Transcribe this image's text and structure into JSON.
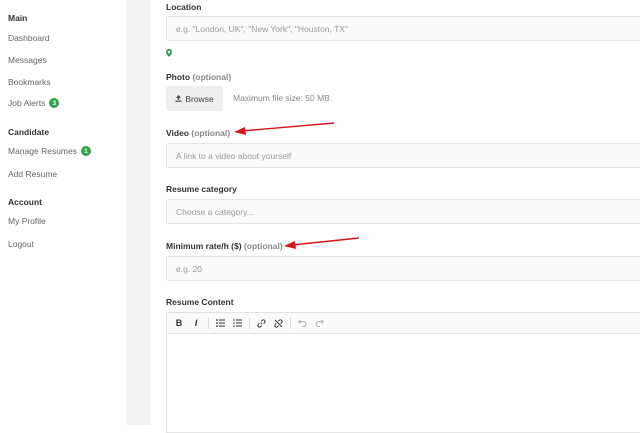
{
  "sidebar": {
    "sections": [
      {
        "title": "Main",
        "items": [
          {
            "label": "Dashboard"
          },
          {
            "label": "Messages"
          },
          {
            "label": "Bookmarks"
          },
          {
            "label": "Job Alerts",
            "badge": "3"
          }
        ]
      },
      {
        "title": "Candidate",
        "items": [
          {
            "label": "Manage Resumes",
            "badge": "1"
          },
          {
            "label": "Add Resume"
          }
        ]
      },
      {
        "title": "Account",
        "items": [
          {
            "label": "My Profile"
          },
          {
            "label": "Logout"
          }
        ]
      }
    ]
  },
  "form": {
    "location": {
      "label": "Location",
      "placeholder": "e.g. \"London, UK\", \"New York\", \"Houston, TX\""
    },
    "photo": {
      "label": "Photo",
      "optional": "(optional)",
      "browse_label": "Browse",
      "hint": "Maximum file size: 50 MB."
    },
    "video": {
      "label": "Video",
      "optional": "(optional)",
      "placeholder": "A link to a video about yourself"
    },
    "category": {
      "label": "Resume category",
      "placeholder": "Choose a category..."
    },
    "rate": {
      "label": "Minimum rate/h ($)",
      "optional": "(optional)",
      "placeholder": "e.g. 20"
    },
    "content": {
      "label": "Resume Content"
    }
  },
  "toolbar": {
    "bold": "B",
    "italic": "I"
  },
  "colors": {
    "badge": "#2ea44f",
    "annotation_arrow": "#d9141b",
    "location_pin": "#2ea44f"
  }
}
